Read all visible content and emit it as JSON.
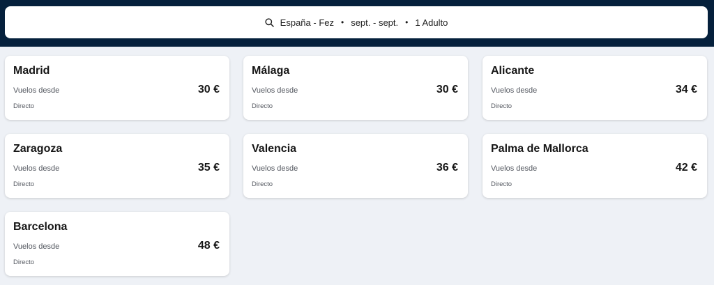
{
  "search": {
    "route": "España - Fez",
    "dates": "sept. - sept.",
    "passengers": "1 Adulto",
    "separator": "•",
    "icon": "search-icon"
  },
  "colors": {
    "header_background": "#05203c",
    "page_background": "#eef1f6",
    "card_background": "#ffffff"
  },
  "destinations": [
    {
      "city": "Madrid",
      "from_label": "Vuelos desde",
      "price": "30 €",
      "stops": "Directo"
    },
    {
      "city": "Málaga",
      "from_label": "Vuelos desde",
      "price": "30 €",
      "stops": "Directo"
    },
    {
      "city": "Alicante",
      "from_label": "Vuelos desde",
      "price": "34 €",
      "stops": "Directo"
    },
    {
      "city": "Zaragoza",
      "from_label": "Vuelos desde",
      "price": "35 €",
      "stops": "Directo"
    },
    {
      "city": "Valencia",
      "from_label": "Vuelos desde",
      "price": "36 €",
      "stops": "Directo"
    },
    {
      "city": "Palma de Mallorca",
      "from_label": "Vuelos desde",
      "price": "42 €",
      "stops": "Directo"
    },
    {
      "city": "Barcelona",
      "from_label": "Vuelos desde",
      "price": "48 €",
      "stops": "Directo"
    }
  ]
}
